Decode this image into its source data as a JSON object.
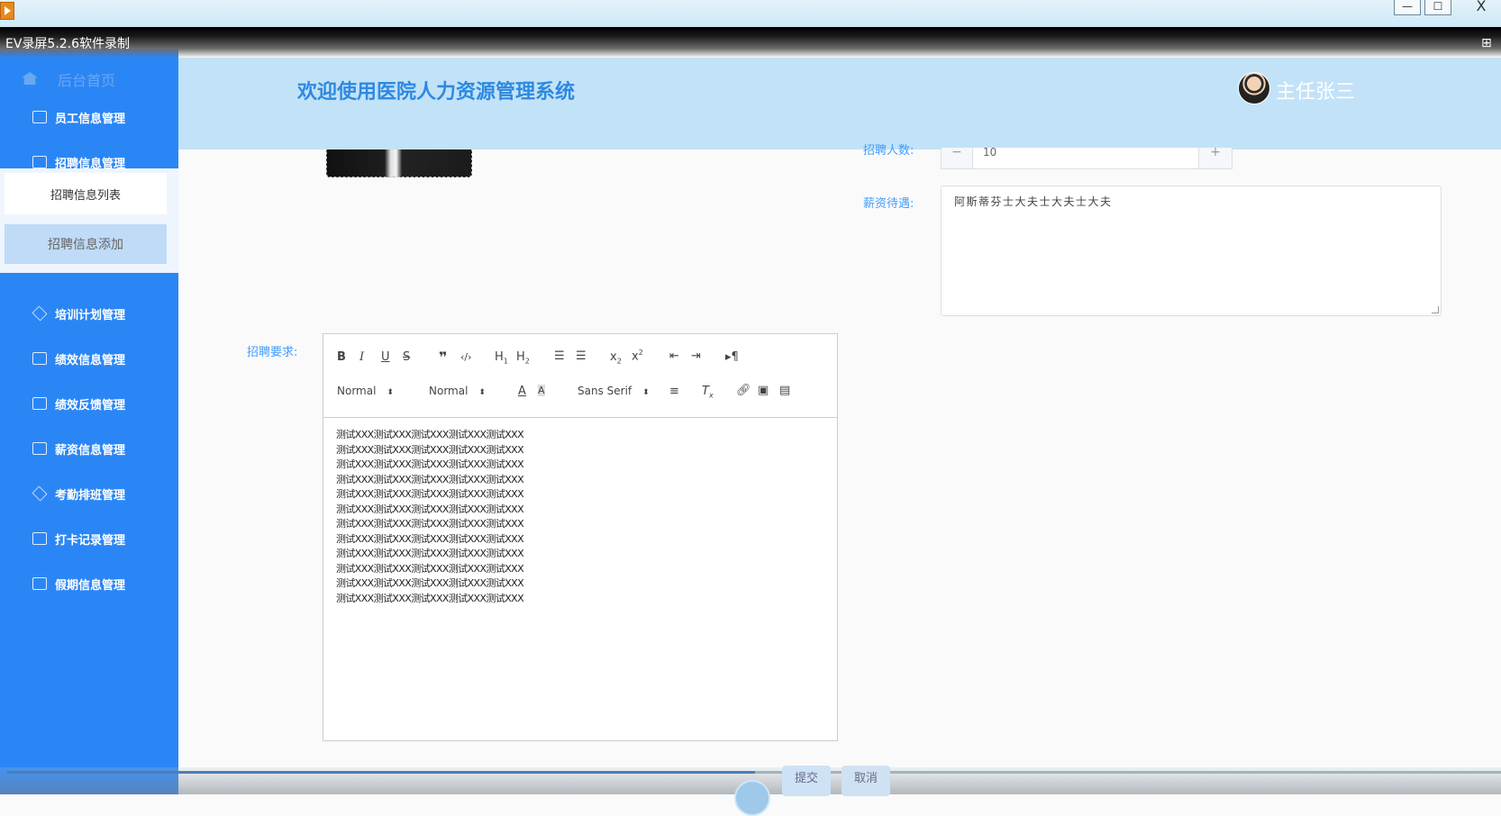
{
  "recorder": {
    "watermark": "EV录屏5.2.6软件录制",
    "minimize": "—",
    "maximize": "☐",
    "close": "X"
  },
  "header": {
    "title": "欢迎使用医院人力资源管理系统",
    "user": "主任张三"
  },
  "sidebar": {
    "home": "后台首页",
    "items": [
      {
        "label": "员工信息管理",
        "icon": "chart-icon"
      },
      {
        "label": "招聘信息管理",
        "icon": "edit-icon"
      },
      {
        "label": "培训计划管理",
        "icon": "diamond-icon"
      },
      {
        "label": "绩效信息管理",
        "icon": "chart-icon"
      },
      {
        "label": "绩效反馈管理",
        "icon": "yen-doc-icon"
      },
      {
        "label": "薪资信息管理",
        "icon": "edit-icon"
      },
      {
        "label": "考勤排班管理",
        "icon": "diamond-icon"
      },
      {
        "label": "打卡记录管理",
        "icon": "edit-icon"
      },
      {
        "label": "假期信息管理",
        "icon": "yen-doc-icon"
      }
    ],
    "submenu": {
      "list": "招聘信息列表",
      "add": "招聘信息添加"
    }
  },
  "form": {
    "headcount_label": "招聘人数:",
    "headcount_value": "10",
    "salary_label": "薪资待遇:",
    "salary_value": "阿斯蒂芬士大夫士大夫士大夫",
    "requirements_label": "招聘要求:",
    "editor": {
      "header_picker": "Normal",
      "size_picker": "Normal",
      "font_picker": "Sans Serif",
      "lines": [
        "测试XXX测试XXX测试XXX测试XXX测试XXX",
        "测试XXX测试XXX测试XXX测试XXX测试XXX",
        "测试XXX测试XXX测试XXX测试XXX测试XXX",
        "测试XXX测试XXX测试XXX测试XXX测试XXX",
        "测试XXX测试XXX测试XXX测试XXX测试XXX",
        "测试XXX测试XXX测试XXX测试XXX测试XXX",
        "测试XXX测试XXX测试XXX测试XXX测试XXX",
        "测试XXX测试XXX测试XXX测试XXX测试XXX",
        "测试XXX测试XXX测试XXX测试XXX测试XXX",
        "测试XXX测试XXX测试XXX测试XXX测试XXX",
        "测试XXX测试XXX测试XXX测试XXX测试XXX",
        "测试XXX测试XXX测试XXX测试XXX测试XXX"
      ]
    },
    "submit": "提交",
    "cancel": "取消"
  }
}
